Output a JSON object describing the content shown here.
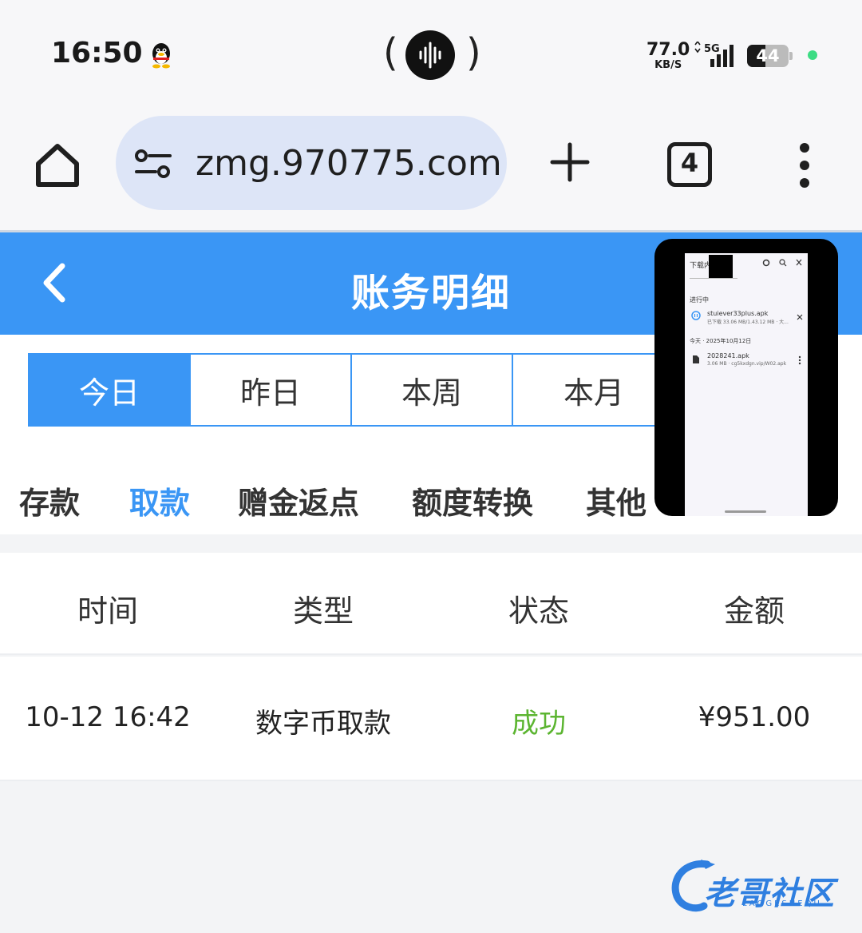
{
  "status_bar": {
    "time": "16:50",
    "net_speed_value": "77.0",
    "net_speed_unit": "KB/S",
    "network": "5G",
    "battery": "44",
    "battery_level_percent": 44
  },
  "browser": {
    "url": "zmg.970775.com",
    "tab_count": "4"
  },
  "header": {
    "title": "账务明细"
  },
  "period_tabs": [
    {
      "label": "今日",
      "active": true
    },
    {
      "label": "昨日",
      "active": false
    },
    {
      "label": "本周",
      "active": false
    },
    {
      "label": "本月",
      "active": false
    }
  ],
  "category_tabs": [
    {
      "label": "存款",
      "active": false
    },
    {
      "label": "取款",
      "active": true
    },
    {
      "label": "赠金返点",
      "active": false
    },
    {
      "label": "额度转换",
      "active": false
    },
    {
      "label": "其他",
      "active": false
    }
  ],
  "table": {
    "headers": [
      "时间",
      "类型",
      "状态",
      "金额"
    ],
    "rows": [
      {
        "time": "10-12 16:42",
        "type": "数字币取款",
        "status": "成功",
        "amount": "¥951.00"
      }
    ]
  },
  "pip": {
    "title": "下载内",
    "section": "进行中",
    "file1": "stuiever33plus.apk",
    "file1_meta": "已下载 33.06 MB/1.43.12 MB · 大...",
    "date_label": "今天 · 2025年10月12日",
    "file2": "2028241.apk",
    "file2_meta": "3.06 MB · cg5kxdgn.vip/W02.apk"
  },
  "watermark": {
    "title": "老哥社区",
    "subtitle": "LAOGESHEQU"
  },
  "colors": {
    "primary": "#3a96f5",
    "success": "#5cb531",
    "url_bar": "#dde5f7"
  }
}
